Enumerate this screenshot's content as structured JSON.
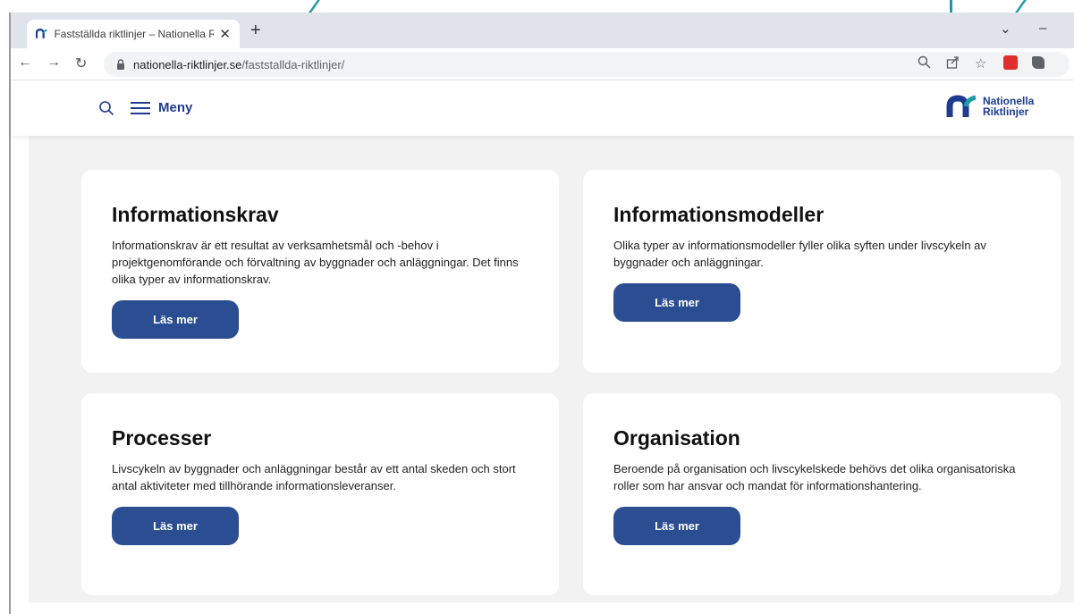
{
  "browser": {
    "tab_title": "Fastställda riktlinjer – Nationella R",
    "tab_close": "✕",
    "new_tab": "+",
    "minimize": "–",
    "chevron": "⌄",
    "url_host": "nationella-riktlinjer.se",
    "url_path": "/faststallda-riktlinjer/"
  },
  "header": {
    "menu_label": "Meny",
    "logo_line1": "Nationella",
    "logo_line2": "Riktlinjer"
  },
  "cards": [
    {
      "title": "Informationskrav",
      "text": "Informationskrav är ett resultat av verksamhetsmål och -behov i projektgenomförande och förvaltning av byggnader och anläggningar. Det finns olika typer av informationskrav.",
      "button": "Läs mer"
    },
    {
      "title": "Informationsmodeller",
      "text": "Olika typer av informationsmodeller fyller olika syften under livscykeln av byggnader och anläggningar.",
      "button": "Läs mer"
    },
    {
      "title": "Processer",
      "text": "Livscykeln av byggnader och anläggningar består av ett antal skeden och stort antal aktiviteter med tillhörande informationsleveranser.",
      "button": "Läs mer"
    },
    {
      "title": "Organisation",
      "text": "Beroende på organisation och livscykelskede behövs det olika organisatoriska roller som har ansvar och mandat för informationshantering.",
      "button": "Läs mer"
    }
  ],
  "colors": {
    "brand_blue": "#1d3c8f",
    "button_blue": "#2b4d91",
    "accent_teal": "#1f9aa8"
  }
}
